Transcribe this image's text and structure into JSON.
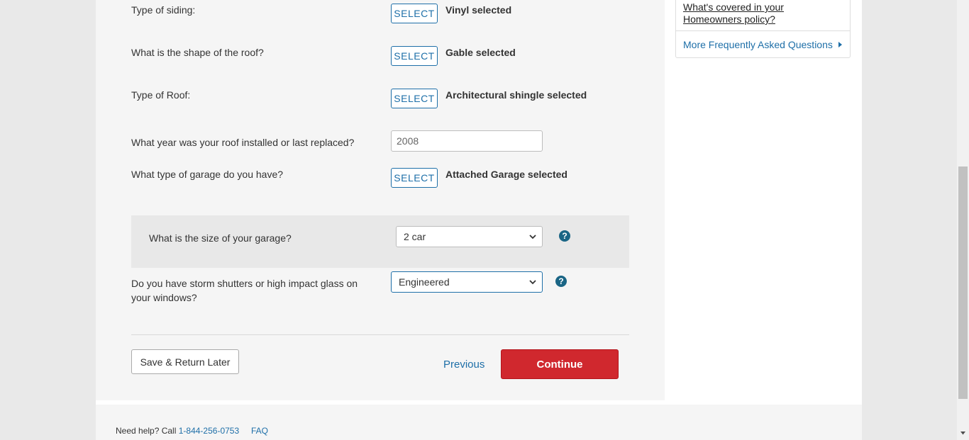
{
  "questions": {
    "siding": {
      "label": "Type of siding:",
      "button": "SELECT",
      "selected": "Vinyl selected"
    },
    "roof_shape": {
      "label": "What is the shape of the roof?",
      "button": "SELECT",
      "selected": "Gable selected"
    },
    "roof_type": {
      "label": "Type of Roof:",
      "button": "SELECT",
      "selected": "Architectural shingle selected"
    },
    "roof_year": {
      "label": "What year was your roof installed or last replaced?",
      "value": "2008"
    },
    "garage_type": {
      "label": "What type of garage do you have?",
      "button": "SELECT",
      "selected": "Attached Garage selected"
    },
    "garage_size": {
      "label": "What is the size of your garage?",
      "value": "2 car",
      "help": "?"
    },
    "storm_shutters": {
      "label_line1": "Do you have storm shutters or high impact glass on",
      "label_line2": "your windows?",
      "value": "Engineered",
      "help": "?"
    }
  },
  "actions": {
    "save": "Save & Return Later",
    "previous": "Previous",
    "continue": "Continue"
  },
  "faq": {
    "link_line1": "What's covered in your",
    "link_line2": "Homeowners policy?",
    "more": "More Frequently Asked Questions"
  },
  "footer": {
    "help_text": "Need help? Call ",
    "phone": "1-844-256-0753",
    "faq": "FAQ"
  },
  "colors": {
    "accent_blue": "#1e6fa8",
    "continue_red": "#d0282e",
    "help_icon": "#1a6585"
  }
}
